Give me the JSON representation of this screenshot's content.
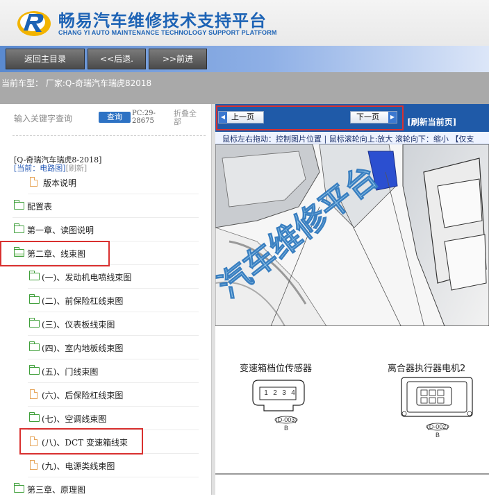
{
  "header": {
    "brand_cn": "畅易汽车维修技术支持平台",
    "brand_en": "CHANG YI AUTO MAINTENANCE TECHNOLOGY SUPPORT PLATFORM",
    "logo_icon": "brand-logo-icon"
  },
  "nav": {
    "home": "返回主目录",
    "back": "<<后退.",
    "forward": ">>前进"
  },
  "car_bar": {
    "text": "当前车型： 厂家:Q-奇瑞汽车瑞虎82018"
  },
  "sidebar": {
    "search_label": "输入关键字查询",
    "search_button": "查询",
    "pc_code_line1": "PC:29-",
    "pc_code_line2": "28675",
    "collapse_line1": "折叠全",
    "collapse_line2": "部",
    "car_link": "[Q-奇瑞汽车瑞虎8-2018]",
    "current_label": "[当前：电路图]",
    "refresh_label": "[刷新]",
    "items": [
      {
        "label": "版本说明",
        "icon": "page-icon"
      },
      {
        "label": "配置表",
        "icon": "folder-icon"
      },
      {
        "label": "第一章、读图说明",
        "icon": "folder-icon"
      },
      {
        "label": "第二章、线束图",
        "icon": "folder-open-icon"
      },
      {
        "label": "(一)、发动机电喷线束图",
        "icon": "folder-icon"
      },
      {
        "label": "(二)、前保险杠线束图",
        "icon": "folder-icon"
      },
      {
        "label": "(三)、仪表板线束图",
        "icon": "folder-icon"
      },
      {
        "label": "(四)、室内地板线束图",
        "icon": "folder-icon"
      },
      {
        "label": "(五)、门线束图",
        "icon": "folder-icon"
      },
      {
        "label": "(六)、后保险杠线束图",
        "icon": "page-icon"
      },
      {
        "label": "(七)、空调线束图",
        "icon": "folder-icon"
      },
      {
        "label": "(八)、DCT 变速箱线束",
        "icon": "page-icon"
      },
      {
        "label": "(九)、电源类线束图",
        "icon": "page-icon"
      },
      {
        "label": "第三章、原理图",
        "icon": "folder-icon"
      }
    ]
  },
  "viewer": {
    "prev": "上一页",
    "next": "下一页",
    "refresh": "[刷新当前页]",
    "tip": "鼠标左右拖动：控制图片位置 | 鼠标滚轮向上:放大  滚轮向下：缩小 【仅支",
    "watermark": "汽车维修平台",
    "connector1": {
      "name": "变速箱档位传感器",
      "code": "(D-003)",
      "side": "B",
      "pins": [
        "1",
        "2",
        "3",
        "4"
      ]
    },
    "connector2": {
      "name": "离合器执行器电机2",
      "code": "(D-002)",
      "side": "B"
    }
  },
  "colors": {
    "brand_blue": "#1d63b5",
    "highlight_red": "#d9302f",
    "viewer_bar": "#1f5aa8"
  }
}
